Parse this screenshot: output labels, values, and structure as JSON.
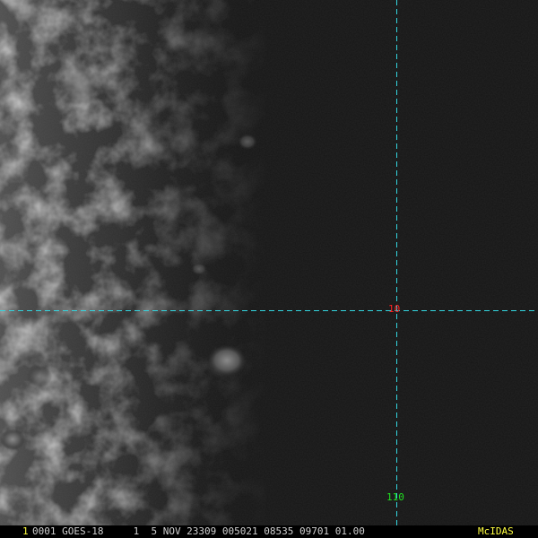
{
  "frame": {
    "number": "1",
    "status_line": "0001 GOES-18     1  5 NOV 23309 005021 08535 09701 01.00",
    "brand": "McIDAS"
  },
  "grid": {
    "latitude_label": "10",
    "longitude_label": "110"
  },
  "colors": {
    "gridline": "#33d6e0",
    "latitude_label": "#ff2020",
    "longitude_label": "#20e020",
    "frame_number": "#ffff40",
    "status_text": "#d0d0d0",
    "brand": "#ffff40",
    "background": "#161616"
  }
}
